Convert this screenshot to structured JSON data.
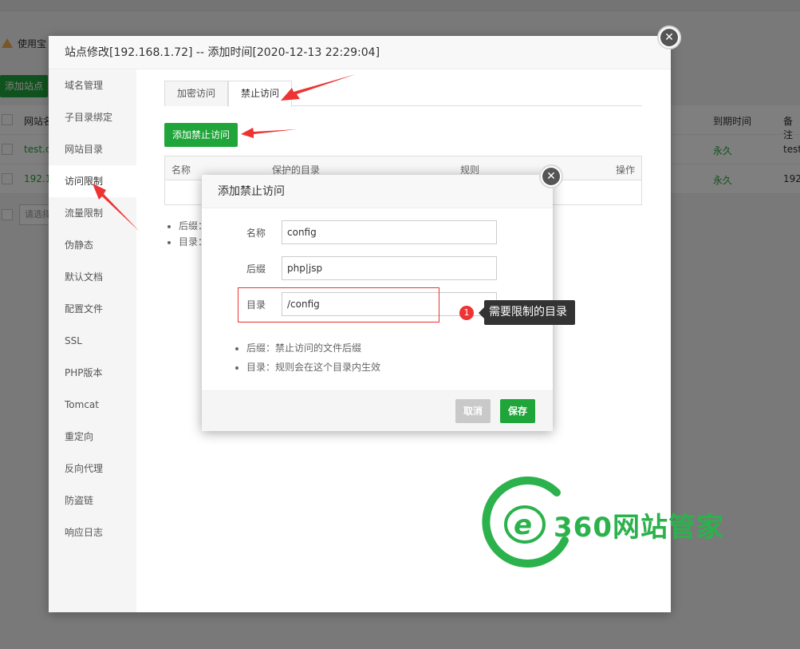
{
  "background": {
    "notice": "使用宝",
    "add_site_button": "添加站点",
    "columns": {
      "site": "网站名",
      "expiry": "到期时间",
      "note": "备注"
    },
    "rows": [
      {
        "site": "test.c",
        "expiry": "永久",
        "note": "test"
      },
      {
        "site": "192.1",
        "expiry": "永久",
        "note": "192"
      }
    ],
    "select_placeholder": "请选择"
  },
  "dialog": {
    "title": "站点修改[192.168.1.72] -- 添加时间[2020-12-13 22:29:04]",
    "sidebar": [
      "域名管理",
      "子目录绑定",
      "网站目录",
      "访问限制",
      "流量限制",
      "伪静态",
      "默认文档",
      "配置文件",
      "SSL",
      "PHP版本",
      "Tomcat",
      "重定向",
      "反向代理",
      "防盗链",
      "响应日志"
    ],
    "active_sidebar_index": 3,
    "tabs": [
      "加密访问",
      "禁止访问"
    ],
    "active_tab_index": 1,
    "add_button": "添加禁止访问",
    "table_headers": {
      "name": "名称",
      "dir": "保护的目录",
      "rule": "规则",
      "action": "操作"
    },
    "notes": [
      "后缀：",
      "目录："
    ]
  },
  "sub_dialog": {
    "title": "添加禁止访问",
    "fields": {
      "name": {
        "label": "名称",
        "value": "config"
      },
      "suffix": {
        "label": "后缀",
        "value": "php|jsp"
      },
      "dir": {
        "label": "目录",
        "value": "/config"
      }
    },
    "notes": [
      "后缀：禁止访问的文件后缀",
      "目录：规则会在这个目录内生效"
    ],
    "cancel_button": "取消",
    "save_button": "保存"
  },
  "tooltip": {
    "badge": "1",
    "text": "需要限制的目录"
  },
  "watermark": {
    "text": "360网站管家"
  },
  "colors": {
    "accent": "#20a53a",
    "annotation": "#e33333"
  }
}
